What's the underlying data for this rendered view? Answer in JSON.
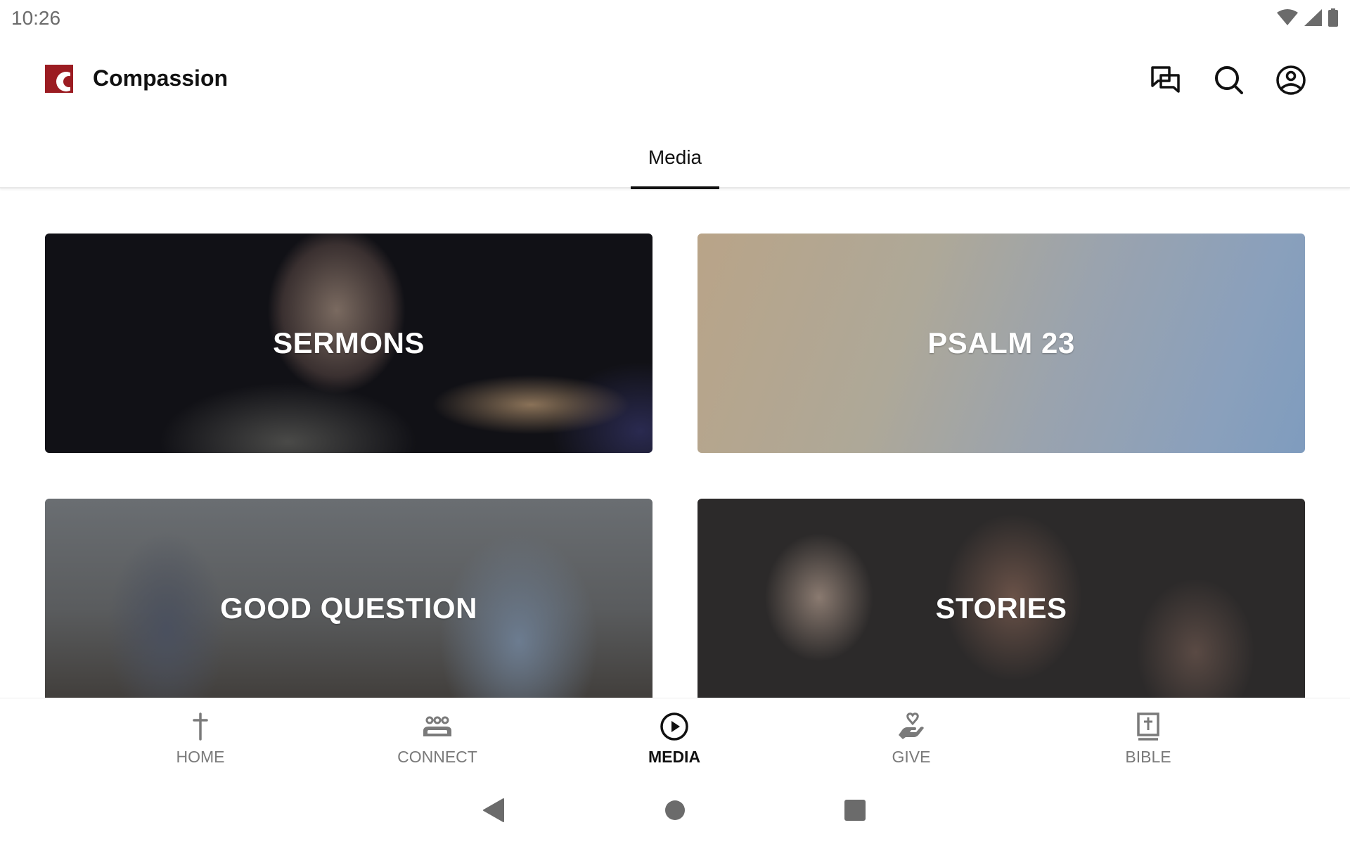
{
  "status_bar": {
    "time": "10:26",
    "icons": [
      "wifi-icon",
      "signal-icon",
      "battery-icon"
    ]
  },
  "app_bar": {
    "title": "Compassion",
    "logo": "compassion-logo",
    "brand_color": "#9b1c22",
    "actions": [
      {
        "name": "messages",
        "icon": "chat-bubbles-icon"
      },
      {
        "name": "search",
        "icon": "search-icon"
      },
      {
        "name": "profile",
        "icon": "account-circle-icon"
      }
    ]
  },
  "tabs": [
    {
      "label": "Media",
      "selected": true
    }
  ],
  "cards": [
    {
      "title": "SERMONS"
    },
    {
      "title": "PSALM 23"
    },
    {
      "title": "GOOD QUESTION"
    },
    {
      "title": "STORIES"
    }
  ],
  "bottom_nav": {
    "items": [
      {
        "label": "HOME",
        "icon": "cross-icon",
        "active": false
      },
      {
        "label": "CONNECT",
        "icon": "group-icon",
        "active": false
      },
      {
        "label": "MEDIA",
        "icon": "play-circle-icon",
        "active": true
      },
      {
        "label": "GIVE",
        "icon": "hand-heart-icon",
        "active": false
      },
      {
        "label": "BIBLE",
        "icon": "bible-icon",
        "active": false
      }
    ]
  },
  "system_nav": {
    "buttons": [
      "back",
      "home",
      "recents"
    ]
  }
}
